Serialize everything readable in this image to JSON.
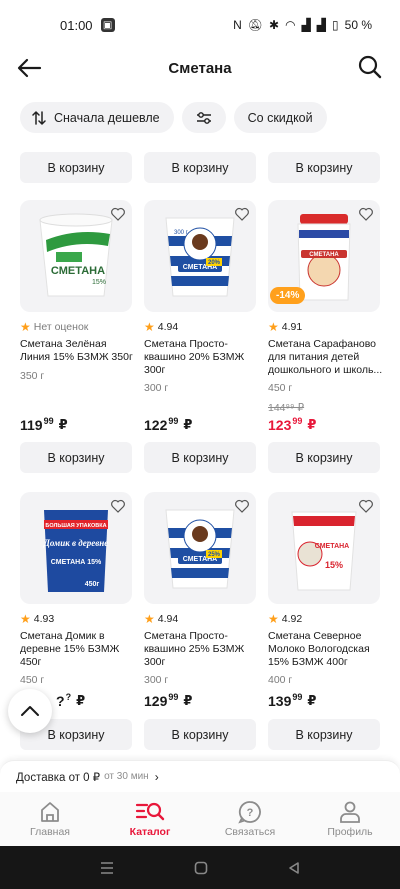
{
  "status": {
    "time": "01:00",
    "battery": "50 %"
  },
  "header": {
    "title": "Сметана"
  },
  "filters": {
    "sort_label": "Сначала дешевле",
    "discount_label": "Со скидкой"
  },
  "cart_label": "В корзину",
  "products": [
    {
      "rating": "Нет оценок",
      "name": "Сметана Зелёная Линия 15% БЗМЖ 350г",
      "weight": "350 г",
      "price": "119",
      "price_kop": "99",
      "currency": "₽"
    },
    {
      "rating": "4.94",
      "name": "Сметана Просто-квашино 20% БЗМЖ 300г",
      "weight": "300 г",
      "price": "122",
      "price_kop": "99",
      "currency": "₽"
    },
    {
      "discount": "-14%",
      "rating": "4.91",
      "name": "Сметана Сарафаново для питания детей дошкольного и школь...",
      "weight": "450 г",
      "old_price": "144⁹⁹ ₽",
      "price": "123",
      "price_kop": "99",
      "currency": "₽"
    },
    {
      "rating": "4.93",
      "name": "Сметана Домик в деревне 15% БЗМЖ 450г",
      "weight": "450 г",
      "price": "?",
      "price_kop": "?",
      "currency": "₽"
    },
    {
      "rating": "4.94",
      "name": "Сметана Просто-квашино 25% БЗМЖ 300г",
      "weight": "300 г",
      "price": "129",
      "price_kop": "99",
      "currency": "₽"
    },
    {
      "rating": "4.92",
      "name": "Сметана Северное Молоко Вологодская 15% БЗМЖ 400г",
      "weight": "400 г",
      "price": "139",
      "price_kop": "99",
      "currency": "₽"
    }
  ],
  "product_images": {
    "p1_label": "СМЕТАНА",
    "p1_sub": "15%",
    "p2_label": "СМЕТАНА",
    "p2_sub": "20%",
    "p2_top": "300 г",
    "p3_label": "СМЕТАНА",
    "p4_banner": "БОЛЬШАЯ УПАКОВКА",
    "p4_brand": "Домик в деревне",
    "p4_label": "СМЕТАНА 15%",
    "p4_weight": "450г",
    "p5_label": "СМЕТАНА",
    "p5_sub": "25%",
    "p6_label": "СМЕТАНА",
    "p6_sub": "15%"
  },
  "delivery": {
    "text": "Доставка от 0 ₽",
    "sub": "от 30 мин"
  },
  "nav": {
    "home": "Главная",
    "catalog": "Каталог",
    "contact": "Связаться",
    "profile": "Профиль"
  },
  "colors": {
    "accent": "#e8173a",
    "star": "#ff9f1a",
    "discount": "#ffa01c"
  }
}
